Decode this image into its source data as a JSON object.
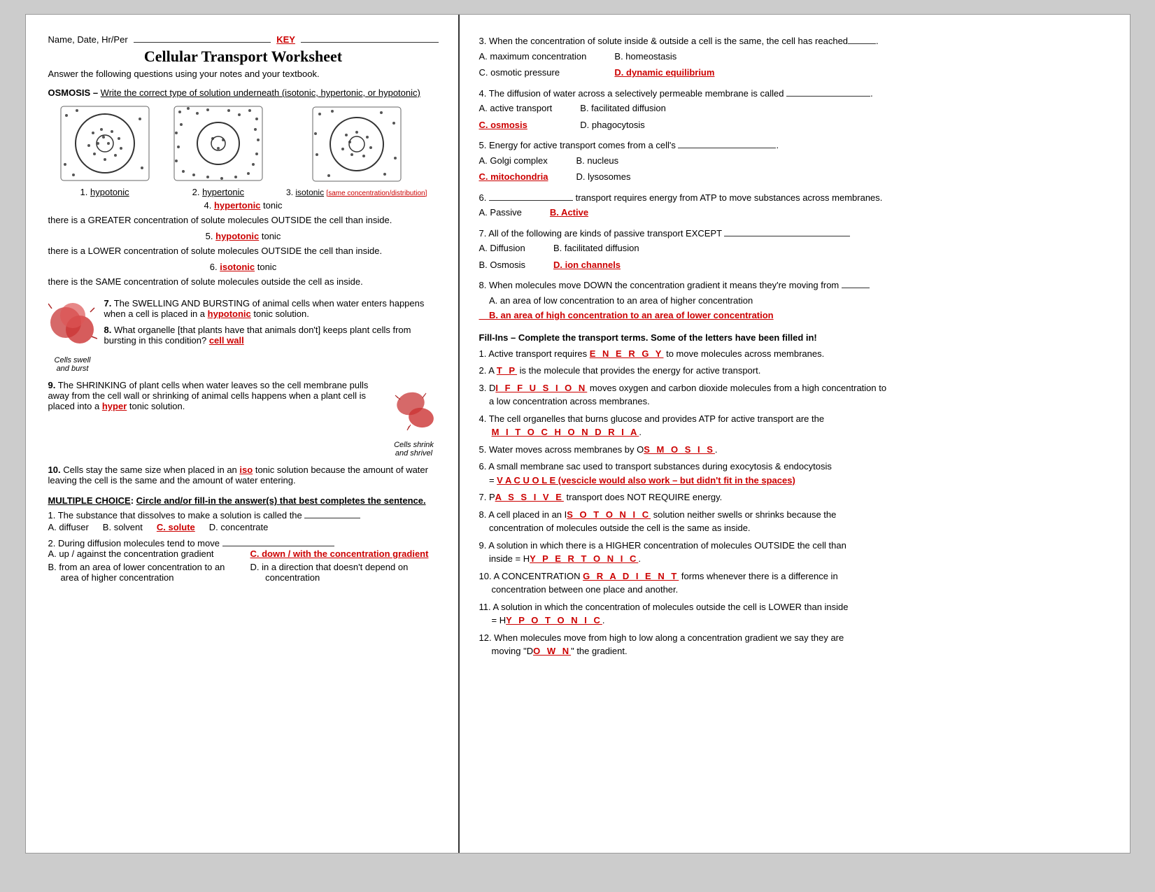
{
  "header": {
    "name_label": "Name, Date, Hr/Per",
    "key_label": "KEY",
    "title": "Cellular Transport Worksheet",
    "subtitle": "Answer the following questions using your notes and your textbook."
  },
  "osmosis_section": {
    "title": "OSMOSIS",
    "dash": "–",
    "instruction": "Write the correct type of solution underneath (isotonic, hypertonic, or hypotonic)",
    "diagrams": [
      {
        "number": "1.",
        "label": "hypotonic",
        "type": "few_dots_outside"
      },
      {
        "number": "2.",
        "label": "hypertonic",
        "type": "many_dots_outside"
      },
      {
        "number": "3.",
        "label": "isotonic",
        "extra": "[same concentration/distribution]",
        "type": "equal_dots"
      }
    ],
    "q4_label": "4.",
    "q4_answer": "hypertonic",
    "q4_text": "tonic",
    "q4_detail": "there is a GREATER concentration of solute molecules OUTSIDE the cell than inside.",
    "q5_label": "5.",
    "q5_answer": "hypotonic",
    "q5_text": "tonic",
    "q5_detail": "there is a LOWER concentration of solute molecules OUTSIDE the cell than inside.",
    "q6_label": "6.",
    "q6_answer": "isotonic",
    "q6_text": "tonic",
    "q6_detail": "there is the SAME concentration of solute molecules outside the cell as inside.",
    "q7_label": "7.",
    "q7_text": "The SWELLING AND BURSTING of animal cells when water enters happens when a cell is placed in a",
    "q7_answer": "hypotonic",
    "q7_end": "tonic solution.",
    "swell_label": "Cells swell\nand burst",
    "q8_label": "8.",
    "q8_text": "What organelle [that plants have that animals don't] keeps plant cells from bursting in this condition?",
    "q8_answer": "cell wall",
    "q9_label": "9.",
    "q9_text_before": "The SHRINKING of plant cells when water leaves so the cell membrane pulls away from the cell wall or shrinking of animal cells happens when a plant cell is placed into a",
    "q9_answer": "hyper",
    "q9_end": "tonic solution.",
    "shrink_label": "Cells shrink\nand shrivel",
    "q10_label": "10.",
    "q10_text_before": "Cells stay the same size when placed in an",
    "q10_answer": "iso",
    "q10_end": "tonic solution because the amount of water leaving the cell is the same and the amount of water entering."
  },
  "mc_section": {
    "title": "MULTIPLE CHOICE",
    "instruction": "Circle and/or fill-in the answer(s) that best completes the sentence.",
    "questions": [
      {
        "number": "1.",
        "text": "The substance that dissolves to make a solution is called the",
        "options": [
          {
            "letter": "A.",
            "text": "diffuser"
          },
          {
            "letter": "B.",
            "text": "solvent"
          },
          {
            "letter": "C.",
            "text": "solute",
            "correct": true
          },
          {
            "letter": "D.",
            "text": "concentrate"
          }
        ]
      },
      {
        "number": "2.",
        "text": "During diffusion molecules tend to move",
        "blank": true,
        "options_a_text": "A.  up / against the concentration gradient",
        "options_c_text": "C. down / with the concentration gradient",
        "options_b_text": "B.  from an area of lower concentration to an area of higher concentration",
        "options_d_text": "D.  in a direction that doesn't depend on concentration"
      }
    ]
  },
  "right_questions": [
    {
      "number": "3.",
      "text": "When the concentration of solute inside & outside a cell is the same, the cell has reached",
      "blank": "____.",
      "options": [
        {
          "letter": "A.",
          "text": "maximum concentration"
        },
        {
          "letter": "B.",
          "text": "homeostasis"
        },
        {
          "letter": "C.",
          "text": "osmotic pressure"
        },
        {
          "letter": "D.",
          "text": "dynamic equilibrium",
          "correct": true
        }
      ]
    },
    {
      "number": "4.",
      "text": "The diffusion of water across a selectively permeable membrane is called",
      "blank": "________________.",
      "options": [
        {
          "letter": "A.",
          "text": "active transport"
        },
        {
          "letter": "B.",
          "text": "facilitated diffusion"
        },
        {
          "letter": "C.",
          "text": "osmosis",
          "correct": true
        },
        {
          "letter": "D.",
          "text": "phagocytosis"
        }
      ]
    },
    {
      "number": "5.",
      "text": "Energy for active transport comes from a cell's",
      "blank": "___________________.",
      "options": [
        {
          "letter": "A.",
          "text": "Golgi complex"
        },
        {
          "letter": "B.",
          "text": "nucleus"
        },
        {
          "letter": "C.",
          "text": "mitochondria",
          "correct": true
        },
        {
          "letter": "D.",
          "text": "lysosomes"
        }
      ]
    },
    {
      "number": "6.",
      "blank_before": "_______________",
      "text": "transport requires energy from ATP to move substances across membranes.",
      "options": [
        {
          "letter": "A.",
          "text": "Passive"
        },
        {
          "letter": "B.",
          "text": "Active",
          "correct": true
        }
      ]
    },
    {
      "number": "7.",
      "text": "All of the following are kinds of passive transport EXCEPT",
      "blank": "___________________________",
      "options": [
        {
          "letter": "A.",
          "text": "Diffusion"
        },
        {
          "letter": "B.",
          "text": "facilitated diffusion"
        },
        {
          "letter": "B2.",
          "text": "Osmosis"
        },
        {
          "letter": "D.",
          "text": "ion channels",
          "correct": true
        }
      ]
    },
    {
      "number": "8.",
      "text": "When molecules move DOWN the concentration gradient it means they're moving from",
      "blank": "_____",
      "option_a": "A.  an area of low concentration to an area of higher concentration",
      "option_b": "B.  an area of high concentration to an area of lower concentration",
      "b_correct": true
    }
  ],
  "fill_ins": {
    "title": "Fill-Ins",
    "dash": "–",
    "instruction": "Complete the transport terms. Some of the letters have been filled in!",
    "items": [
      {
        "number": "1.",
        "text_before": "Active transport requires",
        "answer": "E N E R G Y",
        "text_after": "to move molecules across membranes."
      },
      {
        "number": "2.",
        "text_before": "A",
        "answer": "T P",
        "text_after": "is the molecule that provides the energy for active transport."
      },
      {
        "number": "3.",
        "text_before": "D",
        "answer": "I F F U S I O N",
        "text_after": "moves oxygen and carbon dioxide molecules from a high concentration to a low concentration across membranes."
      },
      {
        "number": "4.",
        "text": "The cell organelles that burns glucose and provides ATP for active transport are the",
        "answer": "M I T O C H O N D R I A"
      },
      {
        "number": "5.",
        "text_before": "Water moves across membranes by",
        "prefix": "O",
        "answer": "S M O S I S",
        "text_after": "."
      },
      {
        "number": "6.",
        "text": "A small membrane sac used to transport substances during exocytosis & endocytosis",
        "answer_line": "= V A C U O L E (vescicle would also work – but didn't fit in the spaces)"
      },
      {
        "number": "7.",
        "prefix": "P",
        "answer": "A S S I V E",
        "text_after": "transport does NOT REQUIRE energy."
      },
      {
        "number": "8.",
        "text": "A cell placed in an",
        "prefix": "I",
        "answer": "S O T O N I C",
        "text_after": "solution neither swells or shrinks because the concentration of molecules outside the cell is the same as inside."
      },
      {
        "number": "9.",
        "text": "A solution in which there is a HIGHER concentration of molecules OUTSIDE the cell than inside  =",
        "prefix": "H",
        "answer": "Y P E R T O N I C",
        "text_after": "."
      },
      {
        "number": "10.",
        "text_before": "A CONCENTRATION",
        "answer": "G R A D I E N T",
        "text_after": "forms whenever there is a difference in concentration between one place and another."
      },
      {
        "number": "11.",
        "text": "A solution in which the concentration of molecules outside the cell is LOWER than inside = H",
        "answer": "Y P O T O N I C",
        "text_after": "."
      },
      {
        "number": "12.",
        "text_before": "When molecules move from high to low along a concentration gradient we say they are moving \"D",
        "answer": "O W N",
        "text_after": "\" the gradient."
      }
    ]
  }
}
